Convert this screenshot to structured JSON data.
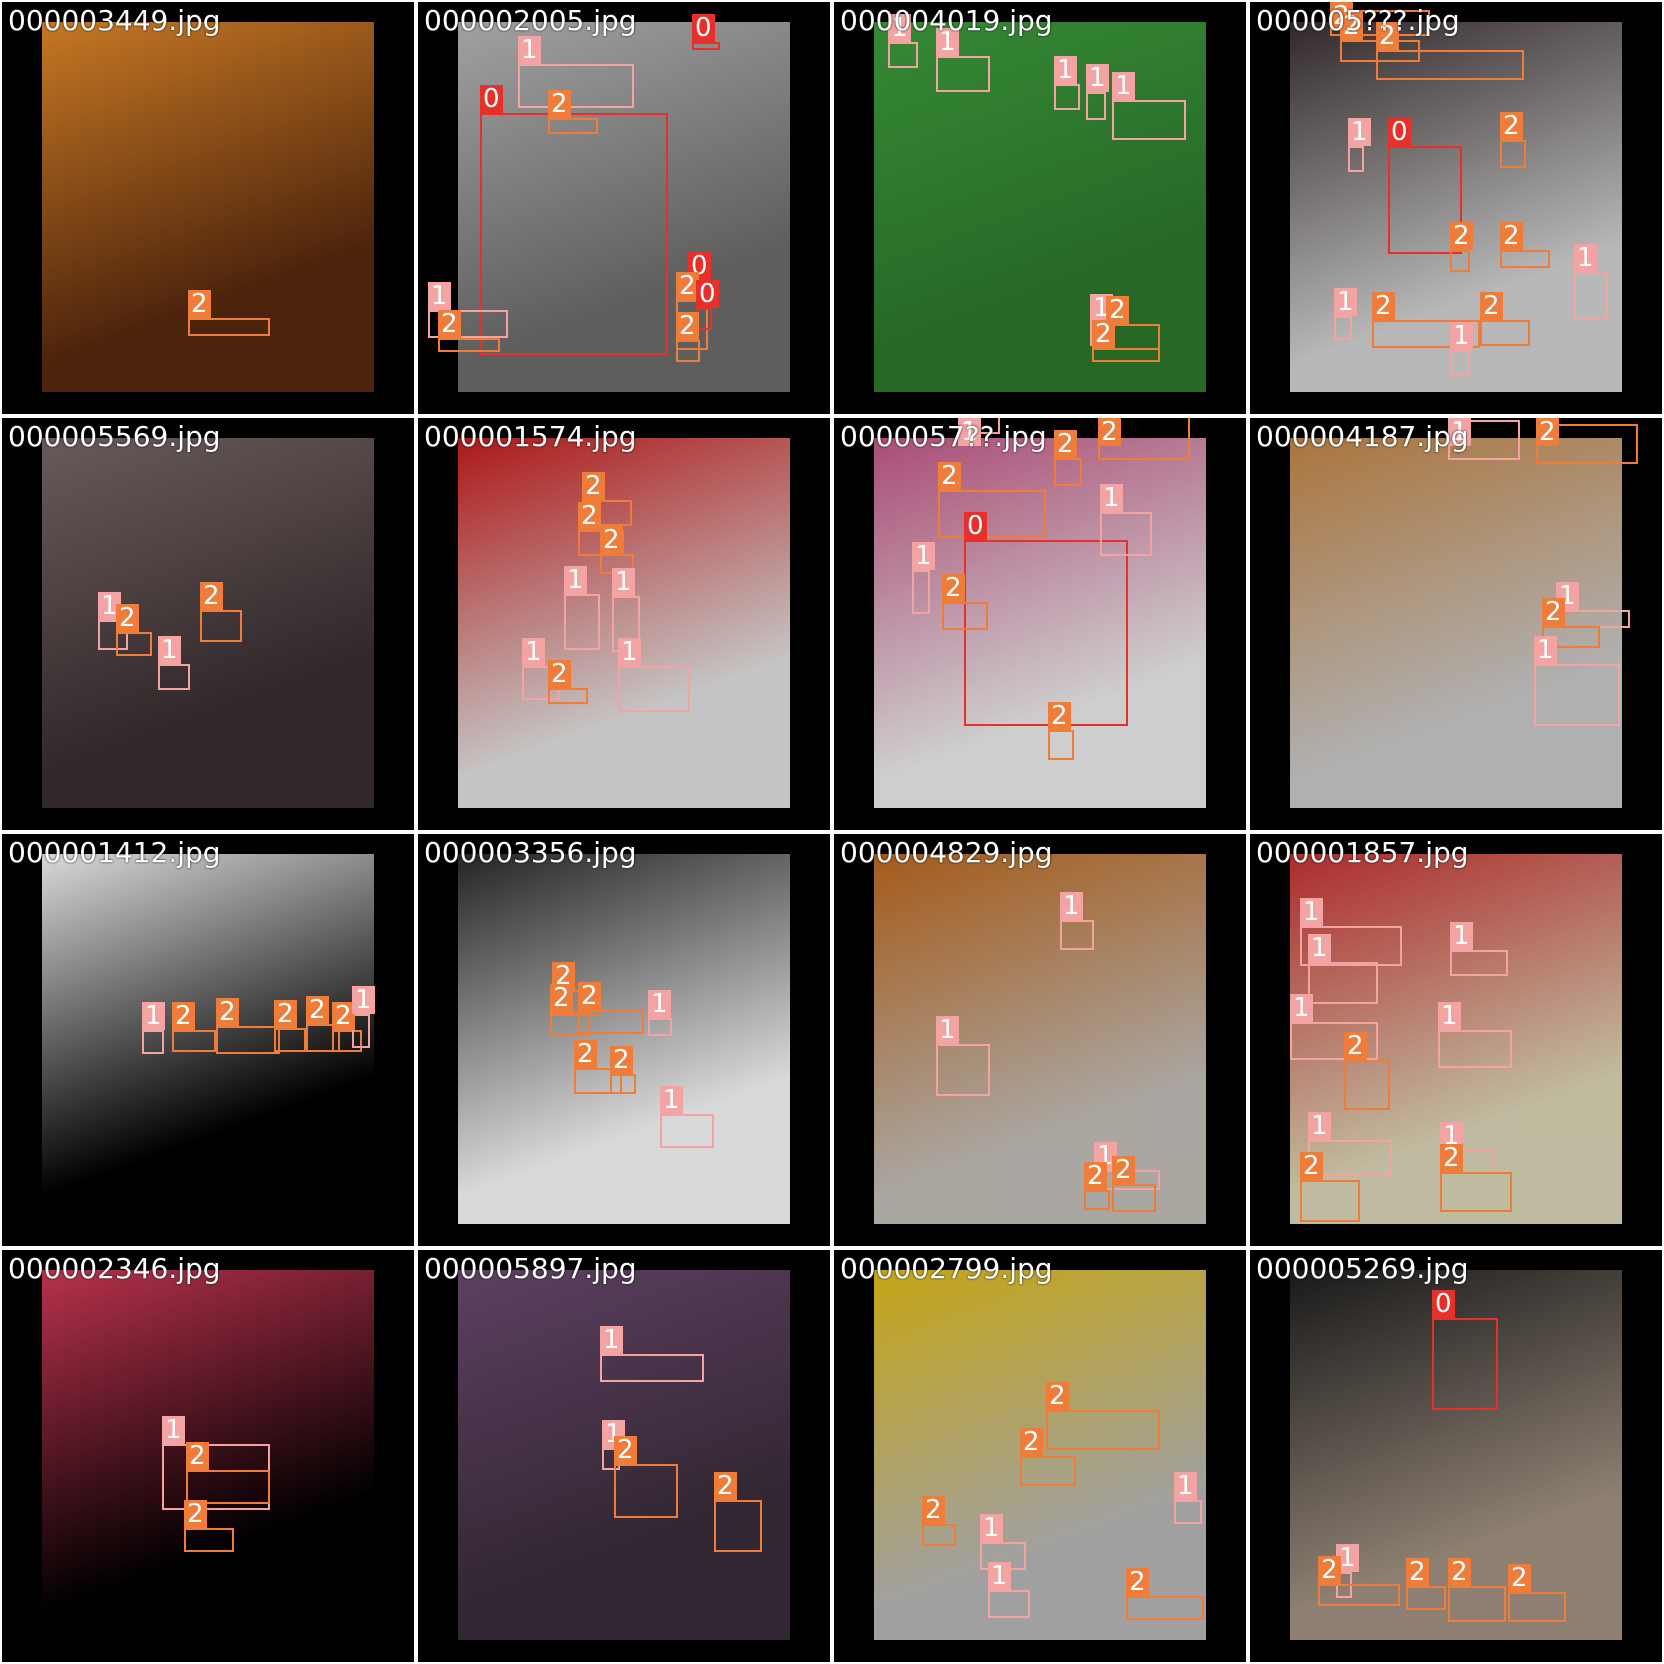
{
  "classes": {
    "0": {
      "color": "#e8302b"
    },
    "1": {
      "color": "#f4a3a3"
    },
    "2": {
      "color": "#f07c3a"
    }
  },
  "tiles": [
    {
      "file": "000003449.jpg",
      "photo": {
        "bg": "#5a2a0e",
        "accent": "#e98d2a"
      },
      "dets": [
        {
          "c": "2",
          "b": [
            188,
            318,
            270,
            336
          ]
        }
      ]
    },
    {
      "file": "000002005.jpg",
      "photo": {
        "bg": "#6f6f6f",
        "accent": "#bdbdbd"
      },
      "dets": [
        {
          "c": "0",
          "b": [
            480,
            113,
            668,
            355
          ]
        },
        {
          "c": "1",
          "b": [
            518,
            64,
            634,
            108
          ]
        },
        {
          "c": "2",
          "b": [
            548,
            118,
            598,
            134
          ]
        },
        {
          "c": "1",
          "b": [
            428,
            310,
            508,
            338
          ]
        },
        {
          "c": "2",
          "b": [
            438,
            338,
            500,
            352
          ]
        },
        {
          "c": "0",
          "b": [
            692,
            42,
            720,
            50
          ]
        },
        {
          "c": "0",
          "b": [
            688,
            280,
            712,
            290
          ]
        },
        {
          "c": "2",
          "b": [
            676,
            300,
            708,
            350
          ]
        },
        {
          "c": "0",
          "b": [
            696,
            308,
            712,
            330
          ]
        },
        {
          "c": "2",
          "b": [
            676,
            340,
            700,
            362
          ]
        }
      ]
    },
    {
      "file": "000004019.jpg",
      "photo": {
        "bg": "#2d7a2d",
        "accent": "#3fa13f"
      },
      "dets": [
        {
          "c": "1",
          "b": [
            888,
            42,
            918,
            68
          ]
        },
        {
          "c": "1",
          "b": [
            936,
            56,
            990,
            92
          ]
        },
        {
          "c": "1",
          "b": [
            1054,
            84,
            1080,
            110
          ]
        },
        {
          "c": "1",
          "b": [
            1086,
            92,
            1106,
            120
          ]
        },
        {
          "c": "1",
          "b": [
            1112,
            100,
            1186,
            140
          ]
        },
        {
          "c": "1",
          "b": [
            1090,
            322,
            1110,
            346
          ]
        },
        {
          "c": "2",
          "b": [
            1106,
            324,
            1160,
            350
          ]
        },
        {
          "c": "2",
          "b": [
            1092,
            348,
            1160,
            362
          ]
        }
      ]
    },
    {
      "file": "000005???.jpg",
      "photo": {
        "bg": "#d8d8d8",
        "accent": "#3a3030"
      },
      "dets": [
        {
          "c": "2",
          "b": [
            1330,
            10,
            1430,
            36
          ]
        },
        {
          "c": "2",
          "b": [
            1340,
            40,
            1420,
            62
          ]
        },
        {
          "c": "2",
          "b": [
            1376,
            50,
            1524,
            80
          ]
        },
        {
          "c": "0",
          "b": [
            1388,
            146,
            1462,
            254
          ]
        },
        {
          "c": "1",
          "b": [
            1348,
            146,
            1364,
            172
          ]
        },
        {
          "c": "2",
          "b": [
            1500,
            140,
            1526,
            168
          ]
        },
        {
          "c": "2",
          "b": [
            1450,
            250,
            1470,
            272
          ]
        },
        {
          "c": "2",
          "b": [
            1500,
            250,
            1550,
            268
          ]
        },
        {
          "c": "1",
          "b": [
            1574,
            272,
            1608,
            320
          ]
        },
        {
          "c": "1",
          "b": [
            1334,
            316,
            1352,
            340
          ]
        },
        {
          "c": "2",
          "b": [
            1372,
            320,
            1480,
            348
          ]
        },
        {
          "c": "2",
          "b": [
            1480,
            320,
            1530,
            346
          ]
        },
        {
          "c": "1",
          "b": [
            1450,
            350,
            1470,
            376
          ]
        }
      ]
    },
    {
      "file": "000005569.jpg",
      "photo": {
        "bg": "#3a2e30",
        "accent": "#7a6a6a"
      },
      "dets": [
        {
          "c": "1",
          "b": [
            98,
            620,
            128,
            650
          ]
        },
        {
          "c": "2",
          "b": [
            116,
            632,
            152,
            656
          ]
        },
        {
          "c": "2",
          "b": [
            200,
            610,
            242,
            642
          ]
        },
        {
          "c": "1",
          "b": [
            158,
            664,
            190,
            690
          ]
        }
      ]
    },
    {
      "file": "000001574.jpg",
      "photo": {
        "bg": "#e8e8e8",
        "accent": "#cc1d1d"
      },
      "dets": [
        {
          "c": "2",
          "b": [
            582,
            500,
            632,
            526
          ]
        },
        {
          "c": "2",
          "b": [
            578,
            530,
            624,
            556
          ]
        },
        {
          "c": "2",
          "b": [
            600,
            554,
            634,
            574
          ]
        },
        {
          "c": "1",
          "b": [
            564,
            594,
            600,
            650
          ]
        },
        {
          "c": "1",
          "b": [
            612,
            596,
            640,
            652
          ]
        },
        {
          "c": "1",
          "b": [
            522,
            666,
            560,
            700
          ]
        },
        {
          "c": "2",
          "b": [
            548,
            688,
            588,
            704
          ]
        },
        {
          "c": "1",
          "b": [
            618,
            666,
            690,
            712
          ]
        }
      ]
    },
    {
      "file": "0000057??.jpg",
      "photo": {
        "bg": "#f2f2f2",
        "accent": "#c85a8a"
      },
      "dets": [
        {
          "c": "0",
          "b": [
            964,
            540,
            1128,
            726
          ]
        },
        {
          "c": "1",
          "b": [
            958,
            400,
            1000,
            434
          ]
        },
        {
          "c": "2",
          "b": [
            1098,
            400,
            1190,
            460
          ]
        },
        {
          "c": "2",
          "b": [
            1054,
            458,
            1082,
            486
          ]
        },
        {
          "c": "1",
          "b": [
            1100,
            512,
            1152,
            556
          ]
        },
        {
          "c": "2",
          "b": [
            938,
            490,
            1046,
            538
          ]
        },
        {
          "c": "1",
          "b": [
            912,
            570,
            930,
            614
          ]
        },
        {
          "c": "2",
          "b": [
            942,
            602,
            988,
            630
          ]
        },
        {
          "c": "2",
          "b": [
            1048,
            730,
            1074,
            760
          ]
        }
      ]
    },
    {
      "file": "000004187.jpg",
      "photo": {
        "bg": "#cfcfcf",
        "accent": "#c98a48"
      },
      "dets": [
        {
          "c": "1",
          "b": [
            1448,
            420,
            1520,
            460
          ]
        },
        {
          "c": "2",
          "b": [
            1536,
            424,
            1638,
            464
          ]
        },
        {
          "c": "1",
          "b": [
            1556,
            610,
            1630,
            628
          ]
        },
        {
          "c": "2",
          "b": [
            1542,
            626,
            1600,
            648
          ]
        },
        {
          "c": "1",
          "b": [
            1534,
            664,
            1620,
            726
          ]
        }
      ]
    },
    {
      "file": "000001412.jpg",
      "photo": {
        "bg": "#000000",
        "accent": "#ffffff"
      },
      "dets": [
        {
          "c": "1",
          "b": [
            142,
            1030,
            164,
            1054
          ]
        },
        {
          "c": "2",
          "b": [
            172,
            1030,
            216,
            1052
          ]
        },
        {
          "c": "2",
          "b": [
            216,
            1026,
            280,
            1054
          ]
        },
        {
          "c": "2",
          "b": [
            274,
            1028,
            306,
            1052
          ]
        },
        {
          "c": "2",
          "b": [
            306,
            1024,
            340,
            1052
          ]
        },
        {
          "c": "2",
          "b": [
            332,
            1030,
            362,
            1052
          ]
        },
        {
          "c": "1",
          "b": [
            352,
            1014,
            370,
            1048
          ]
        }
      ]
    },
    {
      "file": "000003356.jpg",
      "photo": {
        "bg": "#ffffff",
        "accent": "#2b2b2b"
      },
      "dets": [
        {
          "c": "2",
          "b": [
            552,
            990,
            600,
            1016
          ]
        },
        {
          "c": "2",
          "b": [
            550,
            1012,
            590,
            1036
          ]
        },
        {
          "c": "2",
          "b": [
            578,
            1010,
            644,
            1034
          ]
        },
        {
          "c": "1",
          "b": [
            648,
            1018,
            672,
            1036
          ]
        },
        {
          "c": "2",
          "b": [
            574,
            1068,
            622,
            1094
          ]
        },
        {
          "c": "2",
          "b": [
            610,
            1074,
            636,
            1094
          ]
        },
        {
          "c": "1",
          "b": [
            660,
            1114,
            714,
            1148
          ]
        }
      ]
    },
    {
      "file": "000004829.jpg",
      "photo": {
        "bg": "#c8c3bd",
        "accent": "#c26b1f"
      },
      "dets": [
        {
          "c": "1",
          "b": [
            1060,
            920,
            1094,
            950
          ]
        },
        {
          "c": "1",
          "b": [
            936,
            1044,
            990,
            1096
          ]
        },
        {
          "c": "1",
          "b": [
            1094,
            1170,
            1160,
            1190
          ]
        },
        {
          "c": "2",
          "b": [
            1084,
            1190,
            1110,
            1210
          ]
        },
        {
          "c": "2",
          "b": [
            1112,
            1184,
            1156,
            1212
          ]
        }
      ]
    },
    {
      "file": "000001857.jpg",
      "photo": {
        "bg": "#e2ddbd",
        "accent": "#cc3333"
      },
      "dets": [
        {
          "c": "1",
          "b": [
            1300,
            926,
            1402,
            966
          ]
        },
        {
          "c": "1",
          "b": [
            1308,
            962,
            1378,
            1004
          ]
        },
        {
          "c": "1",
          "b": [
            1450,
            950,
            1508,
            976
          ]
        },
        {
          "c": "1",
          "b": [
            1290,
            1022,
            1378,
            1060
          ]
        },
        {
          "c": "1",
          "b": [
            1438,
            1030,
            1512,
            1068
          ]
        },
        {
          "c": "2",
          "b": [
            1344,
            1060,
            1390,
            1110
          ]
        },
        {
          "c": "1",
          "b": [
            1308,
            1140,
            1392,
            1176
          ]
        },
        {
          "c": "1",
          "b": [
            1440,
            1150,
            1494,
            1174
          ]
        },
        {
          "c": "2",
          "b": [
            1440,
            1172,
            1512,
            1212
          ]
        },
        {
          "c": "2",
          "b": [
            1300,
            1180,
            1360,
            1222
          ]
        }
      ]
    },
    {
      "file": "000002346.jpg",
      "photo": {
        "bg": "#000000",
        "accent": "#d83a5a"
      },
      "dets": [
        {
          "c": "1",
          "b": [
            162,
            1444,
            270,
            1510
          ]
        },
        {
          "c": "2",
          "b": [
            186,
            1470,
            270,
            1504
          ]
        },
        {
          "c": "2",
          "b": [
            184,
            1528,
            234,
            1552
          ]
        }
      ]
    },
    {
      "file": "000005897.jpg",
      "photo": {
        "bg": "#3a2d3a",
        "accent": "#6e4b73"
      },
      "dets": [
        {
          "c": "1",
          "b": [
            600,
            1354,
            704,
            1382
          ]
        },
        {
          "c": "1",
          "b": [
            602,
            1448,
            620,
            1470
          ]
        },
        {
          "c": "2",
          "b": [
            614,
            1464,
            678,
            1518
          ]
        },
        {
          "c": "2",
          "b": [
            714,
            1500,
            762,
            1552
          ]
        }
      ]
    },
    {
      "file": "000002799.jpg",
      "photo": {
        "bg": "#bdbdbd",
        "accent": "#e7c21a"
      },
      "dets": [
        {
          "c": "2",
          "b": [
            1046,
            1410,
            1160,
            1450
          ]
        },
        {
          "c": "2",
          "b": [
            1020,
            1456,
            1076,
            1486
          ]
        },
        {
          "c": "1",
          "b": [
            1174,
            1500,
            1202,
            1524
          ]
        },
        {
          "c": "2",
          "b": [
            922,
            1524,
            956,
            1546
          ]
        },
        {
          "c": "1",
          "b": [
            980,
            1542,
            1026,
            1570
          ]
        },
        {
          "c": "1",
          "b": [
            988,
            1590,
            1030,
            1618
          ]
        },
        {
          "c": "2",
          "b": [
            1126,
            1596,
            1204,
            1620
          ]
        }
      ]
    },
    {
      "file": "000005269.jpg",
      "photo": {
        "bg": "#a69686",
        "accent": "#1e1e1e"
      },
      "dets": [
        {
          "c": "0",
          "b": [
            1432,
            1318,
            1498,
            1410
          ]
        },
        {
          "c": "1",
          "b": [
            1336,
            1572,
            1352,
            1598
          ]
        },
        {
          "c": "2",
          "b": [
            1318,
            1584,
            1400,
            1606
          ]
        },
        {
          "c": "2",
          "b": [
            1406,
            1586,
            1446,
            1610
          ]
        },
        {
          "c": "2",
          "b": [
            1448,
            1586,
            1506,
            1622
          ]
        },
        {
          "c": "2",
          "b": [
            1508,
            1592,
            1566,
            1622
          ]
        }
      ]
    }
  ]
}
